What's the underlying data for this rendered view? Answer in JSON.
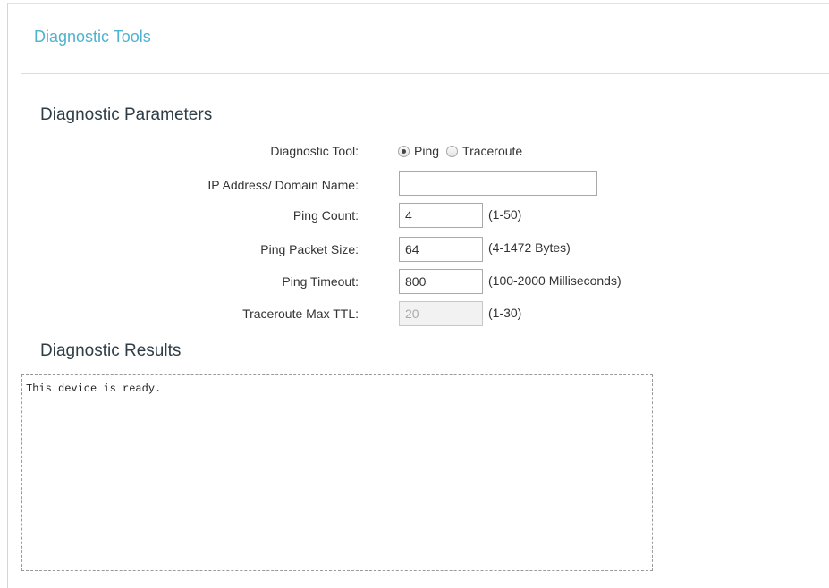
{
  "header": {
    "title": "Diagnostic Tools"
  },
  "parameters": {
    "section_title": "Diagnostic Parameters",
    "diagnostic_tool": {
      "label": "Diagnostic Tool:",
      "options": [
        {
          "label": "Ping",
          "selected": true
        },
        {
          "label": "Traceroute",
          "selected": false
        }
      ]
    },
    "ip_address": {
      "label": "IP Address/ Domain Name:",
      "value": ""
    },
    "ping_count": {
      "label": "Ping Count:",
      "value": "4",
      "hint": "(1-50)"
    },
    "ping_packet_size": {
      "label": "Ping Packet Size:",
      "value": "64",
      "hint": "(4-1472 Bytes)"
    },
    "ping_timeout": {
      "label": "Ping Timeout:",
      "value": "800",
      "hint": "(100-2000 Milliseconds)"
    },
    "traceroute_max_ttl": {
      "label": "Traceroute Max TTL:",
      "value": "20",
      "hint": "(1-30)"
    }
  },
  "results": {
    "section_title": "Diagnostic Results",
    "output": "This device is ready."
  },
  "colors": {
    "title_accent": "#4fb3cf",
    "section_heading": "#2f3e46"
  }
}
